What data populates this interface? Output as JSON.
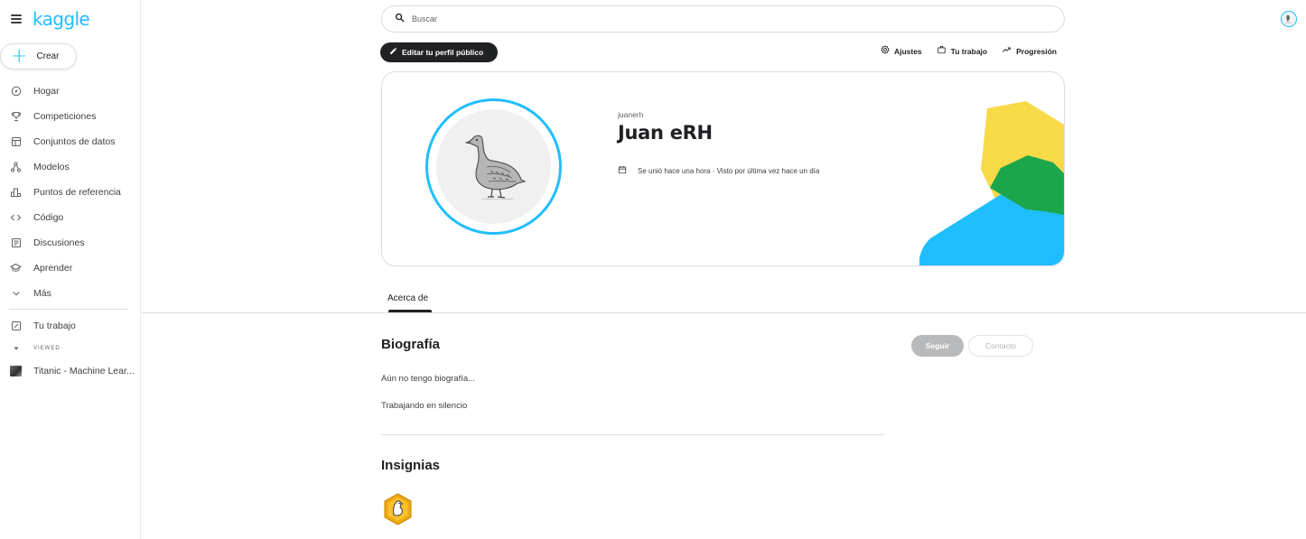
{
  "sidebar": {
    "logo": "kaggle",
    "create_label": "Crear",
    "items": [
      {
        "label": "Hogar",
        "icon": "compass-icon"
      },
      {
        "label": "Competiciones",
        "icon": "trophy-icon"
      },
      {
        "label": "Conjuntos de datos",
        "icon": "table-icon"
      },
      {
        "label": "Modelos",
        "icon": "models-icon"
      },
      {
        "label": "Puntos de referencia",
        "icon": "benchmark-icon"
      },
      {
        "label": "Código",
        "icon": "code-icon"
      },
      {
        "label": "Discusiones",
        "icon": "comment-icon"
      },
      {
        "label": "Aprender",
        "icon": "school-icon"
      },
      {
        "label": "Más",
        "icon": "chevron-down-icon"
      }
    ],
    "your_work_label": "Tu trabajo",
    "viewed_label": "VIEWED",
    "recent_item_label": "Titanic - Machine Lear..."
  },
  "search": {
    "placeholder": "Buscar"
  },
  "toolbar": {
    "edit_profile_label": "Editar tu perfil público",
    "settings_label": "Ajustes",
    "your_work_label": "Tu trabajo",
    "progression_label": "Progresión"
  },
  "profile": {
    "username": "juanerh",
    "display_name": "Juan eRH",
    "joined_text": "Se unió hace una hora · Visto por última vez hace un día"
  },
  "tabs": {
    "about_label": "Acerca de"
  },
  "about": {
    "bio_heading": "Biografía",
    "bio_text": "Aún no tengo biografía...",
    "status_text": "Trabajando en silencio",
    "follow_label": "Seguir",
    "contact_label": "Contacto",
    "badges_heading": "Insignias"
  },
  "colors": {
    "brand": "#20beff",
    "deco_yellow": "#f8d948",
    "deco_green": "#1ca64c",
    "deco_blue": "#1ebeff",
    "badge_orange": "#f0a90f"
  }
}
